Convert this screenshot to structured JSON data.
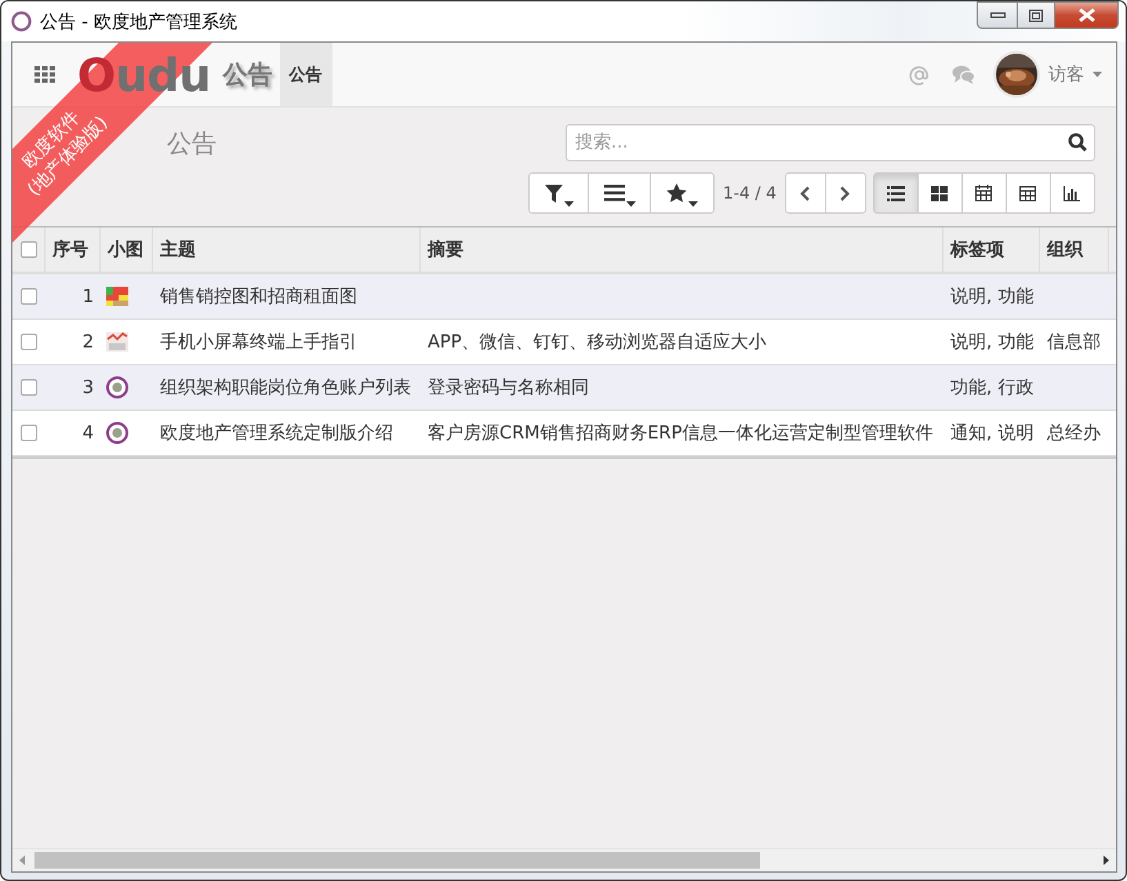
{
  "window": {
    "title": "公告 - 欧度地产管理系统"
  },
  "ribbon": {
    "lines": [
      "欧度软件",
      "(地产体验版)"
    ]
  },
  "navbar": {
    "logo": "Oudu",
    "app_title": "公告",
    "menu": [
      {
        "label": "公告",
        "selected": true
      }
    ],
    "user": {
      "name": "访客"
    }
  },
  "breadcrumb": "公告",
  "search": {
    "placeholder": "搜索..."
  },
  "pager": "1-4 / 4",
  "views": [
    {
      "kind": "list",
      "selected": true
    },
    {
      "kind": "kanban",
      "selected": false
    },
    {
      "kind": "calendar",
      "selected": false
    },
    {
      "kind": "grid",
      "selected": false
    },
    {
      "kind": "graph",
      "selected": false
    }
  ],
  "table": {
    "select_all": {
      "checked": false
    },
    "columns": [
      "序号",
      "小图",
      "主题",
      "摘要",
      "标签项",
      "组织"
    ],
    "rows": [
      {
        "checked": false,
        "number": "1",
        "thumbnail": {
          "kind": "plan"
        },
        "subject": "销售销控图和招商租面图",
        "tags": "说明, 功能"
      },
      {
        "checked": false,
        "number": "2",
        "thumbnail": {
          "kind": "phone"
        },
        "subject": "手机小屏幕终端上手指引",
        "summary": "APP、微信、钉钉、移动浏览器自适应大小",
        "tags": "说明, 功能",
        "organization": "信息部"
      },
      {
        "checked": false,
        "number": "3",
        "thumbnail": {
          "kind": "badge"
        },
        "subject": "组织架构职能岗位角色账户列表",
        "summary": "登录密码与名称相同",
        "tags": "功能, 行政"
      },
      {
        "checked": false,
        "number": "4",
        "thumbnail": {
          "kind": "badge"
        },
        "subject": "欧度地产管理系统定制版介绍",
        "summary": "客户房源CRM销售招商财务ERP信息一体化运营定制型管理软件",
        "tags": "通知, 说明",
        "organization": "总经办"
      }
    ]
  }
}
